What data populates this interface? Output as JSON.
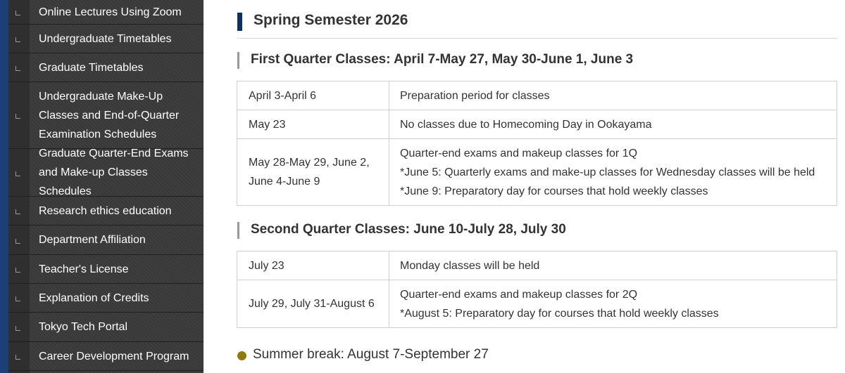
{
  "sidebar": {
    "items": [
      {
        "label": "Online Lectures Using Zoom"
      },
      {
        "label": "Undergraduate Timetables"
      },
      {
        "label": "Graduate Timetables"
      },
      {
        "label": "Undergraduate Make-Up Classes and End-of-Quarter Examination Schedules"
      },
      {
        "label": "Graduate Quarter-End Exams and Make-up Classes Schedules"
      },
      {
        "label": "Research ethics education"
      },
      {
        "label": "Department Affiliation"
      },
      {
        "label": "Teacher's License"
      },
      {
        "label": "Explanation of Credits"
      },
      {
        "label": "Tokyo Tech Portal"
      },
      {
        "label": "Career Development Program"
      }
    ]
  },
  "main": {
    "semester_title": "Spring Semester 2026",
    "first_quarter": {
      "title": "First Quarter Classes: April 7-May 27, May 30-June 1, June 3",
      "rows": [
        {
          "date": "April 3-April 6",
          "desc": [
            "Preparation period for classes"
          ]
        },
        {
          "date": "May 23",
          "desc": [
            "No classes due to Homecoming Day in Ookayama"
          ]
        },
        {
          "date_lines": [
            "May 28-May 29, June 2,",
            "June 4-June 9"
          ],
          "desc": [
            "Quarter-end exams and makeup classes for 1Q",
            "*June 5: Quarterly exams and make-up classes for Wednesday classes will be held",
            "*June 9: Preparatory day for courses that hold weekly classes"
          ]
        }
      ]
    },
    "second_quarter": {
      "title": "Second Quarter Classes: June 10-July 28, July 30",
      "rows": [
        {
          "date": "July 23",
          "desc": [
            "Monday classes will be held"
          ]
        },
        {
          "date": "July 29, July 31-August 6",
          "desc": [
            "Quarter-end exams and makeup classes for 2Q",
            "*August 5: Preparatory day for courses that hold weekly classes"
          ]
        }
      ]
    },
    "summer_break": "Summer break: August 7-September 27"
  },
  "colors": {
    "sidebar_bg": "#3a3a3a",
    "sidebar_accent": "#1c3f7a",
    "heading_bar": "#0d2f66",
    "summer_dot": "#8d7a12"
  }
}
